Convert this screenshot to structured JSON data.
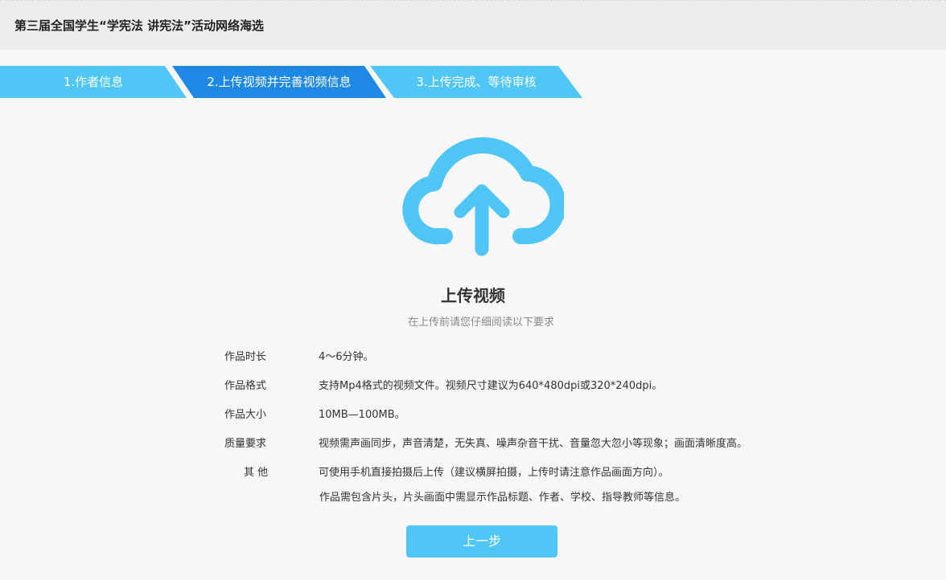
{
  "header": {
    "title": "第三届全国学生“学宪法 讲宪法”活动网络海选"
  },
  "steps": [
    {
      "label": "1.作者信息",
      "active": false
    },
    {
      "label": "2.上传视频并完善视频信息",
      "active": true
    },
    {
      "label": "3.上传完成、等待审核",
      "active": false
    }
  ],
  "upload": {
    "icon": "cloud-upload-icon",
    "title": "上传视频",
    "subtitle": "在上传前请您仔细阅读以下要求"
  },
  "requirements": [
    {
      "label": "作品时长",
      "value": "4～6分钟。"
    },
    {
      "label": "作品格式",
      "value": "支持Mp4格式的视频文件。视频尺寸建议为640*480dpi或320*240dpi。"
    },
    {
      "label": "作品大小",
      "value": "10MB—100MB。"
    },
    {
      "label": "质量要求",
      "value": "视频需声画同步，声音清楚，无失真、噪声杂音干扰、音量忽大忽小等现象；画面清晰度高。"
    },
    {
      "label": "其 他",
      "value": "可使用手机直接拍摄后上传（建议横屏拍摄，上传时请注意作品画面方向）。"
    }
  ],
  "extra_note": "作品需包含片头，片头画面中需显示作品标题、作者、学校、指导教师等信息。",
  "buttons": {
    "prev_label": "上一步"
  },
  "colors": {
    "accent": "#4fc6f5",
    "active_step": "#1e88e5",
    "background": "#f7f7f7",
    "header_bg": "#ececec"
  }
}
